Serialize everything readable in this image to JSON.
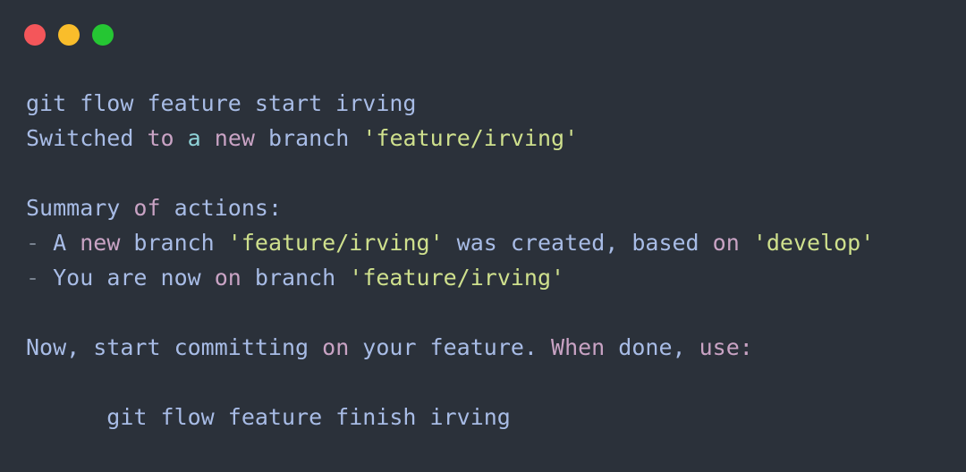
{
  "window": {
    "background": "#2b313a",
    "traffic_lights": [
      {
        "name": "close-button",
        "color": "#f4565a"
      },
      {
        "name": "minimize-button",
        "color": "#f9bd2b"
      },
      {
        "name": "maximize-button",
        "color": "#25c633"
      }
    ]
  },
  "colors": {
    "blue": "#a8bce6",
    "pink": "#c9a3c4",
    "cyan": "#8fd3d8",
    "green": "#cfe08d",
    "dim": "#78828f"
  },
  "terminal": {
    "lines": [
      {
        "id": "command-line",
        "segments": [
          {
            "text": "git flow feature start irving",
            "color": "blue"
          }
        ]
      },
      {
        "id": "switched-line",
        "segments": [
          {
            "text": "Switched ",
            "color": "blue"
          },
          {
            "text": "to",
            "color": "pink"
          },
          {
            "text": " ",
            "color": "blue"
          },
          {
            "text": "a",
            "color": "cyan"
          },
          {
            "text": " ",
            "color": "blue"
          },
          {
            "text": "new",
            "color": "pink"
          },
          {
            "text": " branch ",
            "color": "blue"
          },
          {
            "text": "'feature/irving'",
            "color": "green"
          }
        ]
      },
      {
        "id": "blank-line-1",
        "segments": [
          {
            "text": "",
            "color": "blue"
          }
        ]
      },
      {
        "id": "summary-header-line",
        "segments": [
          {
            "text": "Summary ",
            "color": "blue"
          },
          {
            "text": "of",
            "color": "pink"
          },
          {
            "text": " actions:",
            "color": "blue"
          }
        ]
      },
      {
        "id": "bullet-line-1",
        "segments": [
          {
            "text": "- ",
            "color": "dim"
          },
          {
            "text": "A ",
            "color": "blue"
          },
          {
            "text": "new",
            "color": "pink"
          },
          {
            "text": " branch ",
            "color": "blue"
          },
          {
            "text": "'feature/irving'",
            "color": "green"
          },
          {
            "text": " was created, based ",
            "color": "blue"
          },
          {
            "text": "on",
            "color": "pink"
          },
          {
            "text": " ",
            "color": "blue"
          },
          {
            "text": "'develop'",
            "color": "green"
          }
        ]
      },
      {
        "id": "bullet-line-2",
        "segments": [
          {
            "text": "- ",
            "color": "dim"
          },
          {
            "text": "You are now ",
            "color": "blue"
          },
          {
            "text": "on",
            "color": "pink"
          },
          {
            "text": " branch ",
            "color": "blue"
          },
          {
            "text": "'feature/irving'",
            "color": "green"
          }
        ]
      },
      {
        "id": "blank-line-2",
        "segments": [
          {
            "text": "",
            "color": "blue"
          }
        ]
      },
      {
        "id": "next-step-line",
        "segments": [
          {
            "text": "Now, start committing ",
            "color": "blue"
          },
          {
            "text": "on",
            "color": "pink"
          },
          {
            "text": " your feature. ",
            "color": "blue"
          },
          {
            "text": "When",
            "color": "pink"
          },
          {
            "text": " done, ",
            "color": "blue"
          },
          {
            "text": "use:",
            "color": "pink"
          }
        ]
      },
      {
        "id": "blank-line-3",
        "segments": [
          {
            "text": "",
            "color": "blue"
          }
        ]
      },
      {
        "id": "finish-command-line",
        "segments": [
          {
            "text": "      git flow feature finish irving",
            "color": "blue"
          }
        ]
      }
    ]
  }
}
